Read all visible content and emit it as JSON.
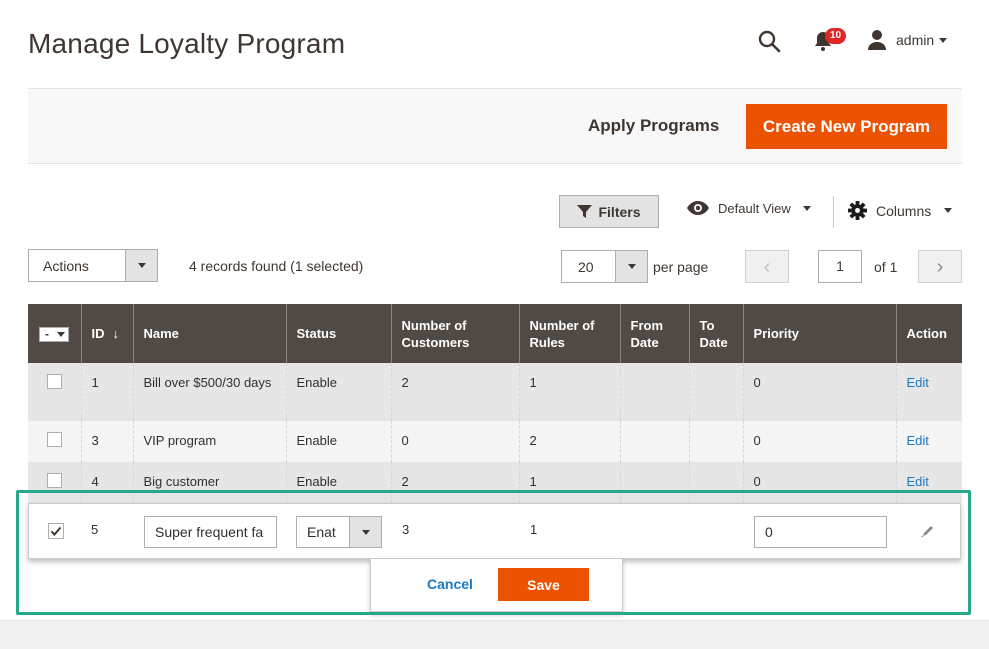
{
  "header": {
    "title": "Manage Loyalty Program",
    "notification_count": "10",
    "user_name": "admin"
  },
  "action_bar": {
    "apply_label": "Apply Programs",
    "create_label": "Create New Program"
  },
  "toolbar": {
    "filters_label": "Filters",
    "view_label": "Default View",
    "columns_label": "Columns",
    "actions_label": "Actions",
    "records_text": "4 records found (1 selected)",
    "per_page_value": "20",
    "per_page_label": "per page",
    "current_page": "1",
    "of_pages": "of 1",
    "prev_symbol": "‹",
    "next_symbol": "›"
  },
  "grid": {
    "headers": {
      "id": "ID",
      "name": "Name",
      "status": "Status",
      "customers": "Number of Customers",
      "rules": "Number of Rules",
      "from_date": "From Date",
      "to_date": "To Date",
      "priority": "Priority",
      "action": "Action"
    },
    "sort_symbol": "↓",
    "mass_select_symbol": "-",
    "rows": [
      {
        "id": "1",
        "name": "Bill over $500/30 days",
        "status": "Enable",
        "customers": "2",
        "rules": "1",
        "from_date": "",
        "to_date": "",
        "priority": "0",
        "action": "Edit"
      },
      {
        "id": "3",
        "name": "VIP program",
        "status": "Enable",
        "customers": "0",
        "rules": "2",
        "from_date": "",
        "to_date": "",
        "priority": "0",
        "action": "Edit"
      },
      {
        "id": "4",
        "name": "Big customer",
        "status": "Enable",
        "customers": "2",
        "rules": "1",
        "from_date": "",
        "to_date": "",
        "priority": "0",
        "action": "Edit"
      }
    ],
    "edit_row": {
      "id": "5",
      "name_value": "Super frequent fa",
      "status_value": "Enat",
      "customers": "3",
      "rules": "1",
      "priority_value": "0",
      "cancel_label": "Cancel",
      "save_label": "Save"
    }
  },
  "colors": {
    "accent": "#eb5202",
    "header_bg": "#514943",
    "link": "#1979c3",
    "highlight": "#26a98a"
  }
}
